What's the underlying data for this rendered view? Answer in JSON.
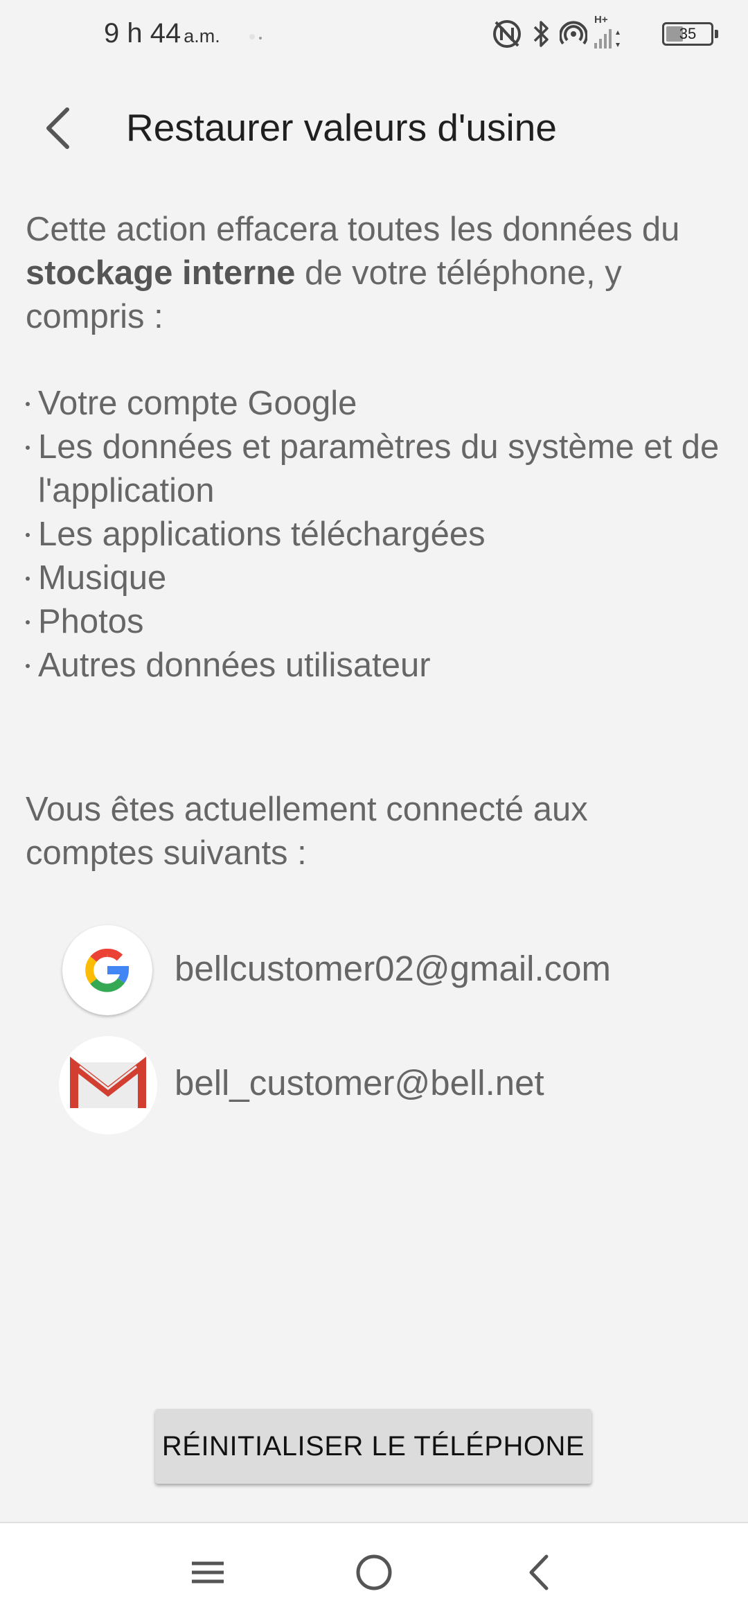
{
  "status_bar": {
    "time": "9 h 44",
    "period": "a.m.",
    "network_label": "H+",
    "battery_level": "35",
    "battery_fraction": 0.35,
    "icons": [
      "nfc-icon",
      "bluetooth-icon",
      "hotspot-icon",
      "signal-icon",
      "battery-icon"
    ]
  },
  "header": {
    "title": "Restaurer valeurs d'usine"
  },
  "intro": {
    "part1": "Cette action effacera toutes les données du ",
    "bold": "stockage interne",
    "part2": " de votre téléphone, y compris :"
  },
  "data_list": [
    "Votre compte Google",
    "Les données et paramètres du système et de l'application",
    "Les applications téléchargées",
    "Musique",
    "Photos",
    "Autres données utilisateur"
  ],
  "accounts_intro": "Vous êtes actuellement connecté aux comptes suivants :",
  "accounts": [
    {
      "email": "bellcustomer02@gmail.com",
      "icon": "google-logo-icon"
    },
    {
      "email": "bell_customer@bell.net",
      "icon": "gmail-logo-icon"
    }
  ],
  "reset_button": "RÉINITIALISER LE TÉLÉPHONE",
  "nav_bar": {
    "icons": [
      "menu-icon",
      "home-icon",
      "back-icon"
    ]
  }
}
